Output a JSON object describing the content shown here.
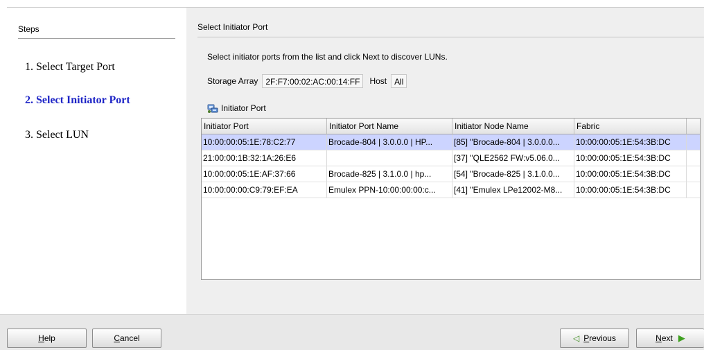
{
  "steps": {
    "header": "Steps",
    "items": [
      {
        "label": "1. Select Target Port",
        "active": false
      },
      {
        "label": "2. Select Initiator Port",
        "active": true
      },
      {
        "label": "3. Select LUN",
        "active": false
      }
    ]
  },
  "panel": {
    "title": "Select Initiator Port",
    "instructions": "Select initiator ports from the list and click Next to discover LUNs.",
    "storage_array_label": "Storage Array",
    "storage_array_value": "2F:F7:00:02:AC:00:14:FF",
    "host_label": "Host",
    "host_value": "All",
    "section_label": "Initiator Port",
    "section_icon": "initiator-port-icon"
  },
  "table": {
    "columns": [
      "Initiator Port",
      "Initiator Port Name",
      "Initiator Node Name",
      "Fabric"
    ],
    "rows": [
      [
        "10:00:00:05:1E:78:C2:77",
        "Brocade-804 | 3.0.0.0 | HP...",
        "[85] \"Brocade-804 | 3.0.0.0...",
        "10:00:00:05:1E:54:3B:DC"
      ],
      [
        "21:00:00:1B:32:1A:26:E6",
        "",
        "[37] \"QLE2562 FW:v5.06.0...",
        "10:00:00:05:1E:54:3B:DC"
      ],
      [
        "10:00:00:05:1E:AF:37:66",
        "Brocade-825 | 3.1.0.0 | hp...",
        "[54] \"Brocade-825 | 3.1.0.0...",
        "10:00:00:05:1E:54:3B:DC"
      ],
      [
        "10:00:00:00:C9:79:EF:EA",
        "Emulex PPN-10:00:00:00:c...",
        "[41] \"Emulex LPe12002-M8...",
        "10:00:00:05:1E:54:3B:DC"
      ]
    ],
    "selected_row": 0
  },
  "footer": {
    "help_mnemonic": "H",
    "help_rest": "elp",
    "cancel_mnemonic": "C",
    "cancel_rest": "ancel",
    "previous_mnemonic": "P",
    "previous_rest": "revious",
    "next_mnemonic": "N",
    "next_rest": "ext"
  },
  "colors": {
    "active_step": "#1d24c6",
    "selected_row": "#ccd4ff",
    "panel_bg": "#efefef",
    "nav_arrow": "#3fa020"
  }
}
